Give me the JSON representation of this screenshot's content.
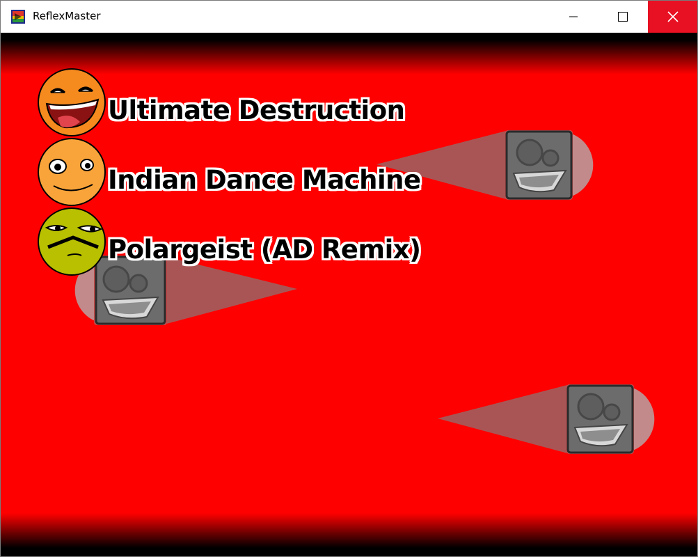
{
  "window": {
    "title": "ReflexMaster",
    "icon": "app-icon",
    "controls": [
      "minimize-icon",
      "maximize-icon",
      "close-icon"
    ]
  },
  "game": {
    "background_color": "#ff0000",
    "songs": [
      {
        "title": "Ultimate Destruction",
        "face": "laughing-face",
        "color": "#f58a1f"
      },
      {
        "title": "Indian Dance Machine",
        "face": "goofy-face",
        "color": "#f9a43a"
      },
      {
        "title": "Polargeist (AD Remix)",
        "face": "annoyed-face",
        "color": "#b8c000"
      }
    ],
    "enemies": [
      {
        "name": "speaker-enemy",
        "cone_direction": "left"
      },
      {
        "name": "speaker-enemy",
        "cone_direction": "right"
      },
      {
        "name": "speaker-enemy",
        "cone_direction": "left"
      }
    ]
  }
}
